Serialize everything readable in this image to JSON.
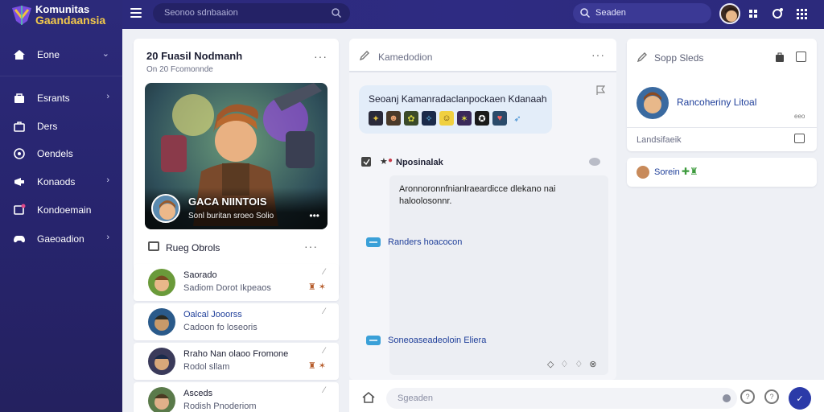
{
  "app": {
    "title_line1": "Komunitas",
    "title_line2": "Gaandaansia"
  },
  "sidebar": {
    "items": [
      {
        "label": "Eone",
        "icon": "home-icon",
        "has_chevron": true
      },
      {
        "label": "Esrants",
        "icon": "bag-icon",
        "has_chevron": true
      },
      {
        "label": "Ders",
        "icon": "briefcase-icon",
        "has_chevron": false
      },
      {
        "label": "Oendels",
        "icon": "circle-icon",
        "has_chevron": false
      },
      {
        "label": "Konaods",
        "icon": "megaphone-icon",
        "has_chevron": true
      },
      {
        "label": "Kondoemain",
        "icon": "chat-icon",
        "has_chevron": false
      },
      {
        "label": "Gaeoadion",
        "icon": "gamepad-icon",
        "has_chevron": true
      }
    ]
  },
  "topbar": {
    "search_placeholder": "Seonoo sdnbaaion",
    "search2_placeholder": "Seaden"
  },
  "left_panel": {
    "title": "20 Fuasil Nodmanh",
    "subtitle": "On 20 Fcomonnde",
    "hero": {
      "name": "GACA NIINTOIS",
      "sub": "Sonl buritan sroeo Solio"
    },
    "section_label": "Rueg Obrols",
    "list": [
      {
        "name": "Saorado",
        "msg": "Sadiom Dorot Ikpeaos"
      },
      {
        "name": "Oalcal Jooorss",
        "msg": "Cadoon fo loseoris"
      },
      {
        "name": "Rraho Nan olaoo Fromone",
        "msg": "Rodol sllam"
      },
      {
        "name": "Asceds",
        "msg": "Rodish Pnoderiom"
      }
    ]
  },
  "center": {
    "header_label": "Kamedodion",
    "bubble_text": "Seoanj Kamanradaclanpockaen Kdanaah",
    "post_title": "Nposinalak",
    "post_text": "Aronnoronnfnianlraeardicce dlekano nai haloolosonnr.",
    "line1": "Randers hoacocon",
    "line2": "Soneoaseadeoloin Eliera"
  },
  "composer": {
    "placeholder": "Sgeaden"
  },
  "right_panel": {
    "header_label": "Sopp Sleds",
    "user_name": "Rancoheriny Litoal",
    "small_label": "eeo",
    "footer_label": "Landsifaeik",
    "card2_label": "Sorein"
  }
}
